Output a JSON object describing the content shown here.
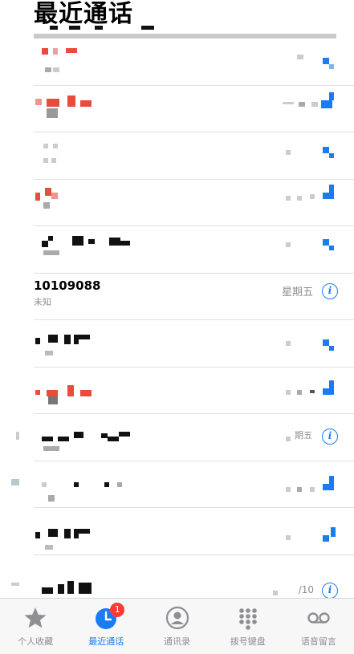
{
  "header": {
    "title": "最近通话"
  },
  "visible_call": {
    "number": "10109088",
    "type_label": "未知",
    "date": "星期五",
    "info_glyph": "i"
  },
  "partial_dates": {
    "row9": "期五",
    "row12": "/10"
  },
  "tab_bar": {
    "tabs": [
      {
        "label": "个人收藏",
        "icon": "star-icon"
      },
      {
        "label": "最近通话",
        "icon": "clock-icon",
        "badge": "1"
      },
      {
        "label": "通讯录",
        "icon": "person-circle-icon"
      },
      {
        "label": "拨号键盘",
        "icon": "keypad-icon"
      },
      {
        "label": "语音留言",
        "icon": "voicemail-icon"
      }
    ],
    "active_tab": "最近通话"
  },
  "colors": {
    "accent_blue": "#1a7bf2",
    "missed_red": "#ff3b30",
    "secondary_gray": "#8e8e93",
    "badge_red": "#ff3b30"
  }
}
